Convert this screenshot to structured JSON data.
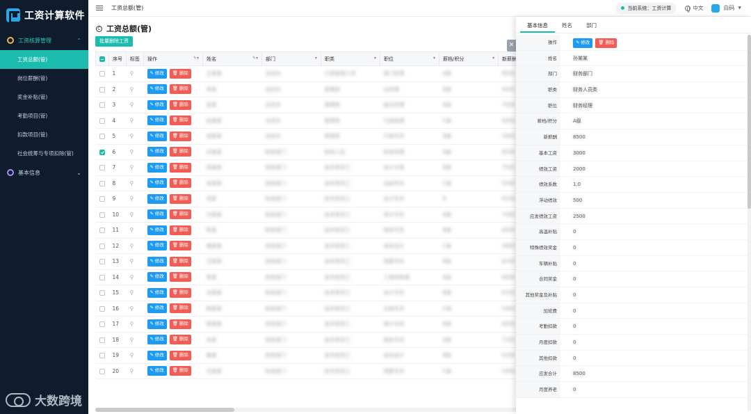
{
  "app": {
    "title": "工资计算软件"
  },
  "sidebar": {
    "groups": [
      {
        "label": "工资核算管理",
        "items": [
          "工资总额(管)",
          "岗位薪酬(管)",
          "奖金补贴(管)",
          "考勤项目(管)",
          "扣款项目(管)",
          "社会统筹与专项扣除(管)"
        ]
      },
      {
        "label": "基本信息"
      }
    ],
    "active_item": "工资总额(管)",
    "watermark": "大数跨境"
  },
  "topbar": {
    "breadcrumb": "工资总额(管)",
    "system_label": "当前系统：工资计算",
    "language": "中文",
    "user": "白码"
  },
  "page": {
    "title": "工资总额(管)",
    "batch_delete_label": "批量删除工资"
  },
  "table": {
    "columns": [
      "序号",
      "标签",
      "操作",
      "姓名",
      "部门",
      "职类",
      "职位",
      "薪档/积分",
      "新薪酬"
    ],
    "edit_label": "修改",
    "delete_label": "删除",
    "rows": [
      {
        "no": "1",
        "checked": false,
        "name": "王某某",
        "dept": "总经办",
        "cat": "行政管理人员",
        "pos": "部门经理",
        "grade": "A级",
        "pay": "8000"
      },
      {
        "no": "2",
        "checked": false,
        "name": "李某",
        "dept": "总经办",
        "cat": "管理类",
        "pos": "总经理",
        "grade": "B级",
        "pay": "9000"
      },
      {
        "no": "3",
        "checked": false,
        "name": "张某",
        "dept": "总经办",
        "cat": "管理类",
        "pos": "副总经理",
        "grade": "A级",
        "pay": "7000"
      },
      {
        "no": "4",
        "checked": false,
        "name": "赵某某",
        "dept": "总经办",
        "cat": "管理类",
        "pos": "行政助理",
        "grade": "C级",
        "pay": "6000"
      },
      {
        "no": "5",
        "checked": false,
        "name": "钱某某",
        "dept": "总经办",
        "cat": "管理类",
        "pos": "行政专员",
        "grade": "B级",
        "pay": "5000"
      },
      {
        "no": "6",
        "checked": true,
        "name": "孙某某",
        "dept": "财务部门",
        "cat": "财务人员",
        "pos": "财务经理",
        "grade": "A级",
        "pay": "8500"
      },
      {
        "no": "7",
        "checked": false,
        "name": "周某某",
        "dept": "财务部门",
        "cat": "技术类员工",
        "pos": "会计主管",
        "grade": "B级",
        "pay": "7500"
      },
      {
        "no": "8",
        "checked": false,
        "name": "吴某某",
        "dept": "财务部门",
        "cat": "技术类员工",
        "pos": "出纳专员",
        "grade": "C级",
        "pay": "5500"
      },
      {
        "no": "9",
        "checked": false,
        "name": "郑某",
        "dept": "财务部门",
        "cat": "技术类员工",
        "pos": "会计专员",
        "grade": "B",
        "pay": "6500"
      },
      {
        "no": "10",
        "checked": false,
        "name": "冯某某",
        "dept": "财务部门",
        "cat": "技术类员工",
        "pos": "审计专员",
        "grade": "A级",
        "pay": "7000"
      },
      {
        "no": "11",
        "checked": false,
        "name": "陈某",
        "dept": "财务部门",
        "cat": "技术类员工",
        "pos": "税务专员",
        "grade": "B级",
        "pay": "6000"
      },
      {
        "no": "12",
        "checked": false,
        "name": "褚某某",
        "dept": "财务部门",
        "cat": "技术类员工",
        "pos": "成本会计",
        "grade": "C级",
        "pay": "5800"
      },
      {
        "no": "13",
        "checked": false,
        "name": "卫某某",
        "dept": "财务部门",
        "cat": "技术类员工",
        "pos": "预算专员",
        "grade": "B级",
        "pay": "6200"
      },
      {
        "no": "14",
        "checked": false,
        "name": "蒋某",
        "dept": "财务部门",
        "cat": "技术类员工",
        "pos": "工程师助理",
        "grade": "A级",
        "pay": "6800"
      },
      {
        "no": "15",
        "checked": false,
        "name": "沈某某",
        "dept": "财务部门",
        "cat": "技术类员工",
        "pos": "会计专员",
        "grade": "B级",
        "pay": "6100"
      },
      {
        "no": "16",
        "checked": false,
        "name": "韩某某",
        "dept": "财务部门",
        "cat": "技术类员工",
        "pos": "出纳专员",
        "grade": "C级",
        "pay": "5400"
      },
      {
        "no": "17",
        "checked": false,
        "name": "杨某某",
        "dept": "财务部门",
        "cat": "技术类员工",
        "pos": "审计专员",
        "grade": "B级",
        "pay": "6600"
      },
      {
        "no": "18",
        "checked": false,
        "name": "朱某",
        "dept": "财务部门",
        "cat": "技术类员工",
        "pos": "税务专员",
        "grade": "A级",
        "pay": "7200"
      },
      {
        "no": "19",
        "checked": false,
        "name": "秦某",
        "dept": "财务部门",
        "cat": "技术类员工",
        "pos": "成本会计",
        "grade": "B级",
        "pay": "6300"
      },
      {
        "no": "20",
        "checked": false,
        "name": "尤某某",
        "dept": "财务部门",
        "cat": "技术类员工",
        "pos": "预算专员",
        "grade": "C级",
        "pay": "5900"
      }
    ]
  },
  "drawer": {
    "tabs": [
      "基本信息",
      "姓名",
      "部门"
    ],
    "active_tab": "基本信息",
    "edit_label": "修改",
    "delete_label": "删除",
    "fields": [
      {
        "label": "操作",
        "value": ""
      },
      {
        "label": "姓名",
        "value": "孙某某"
      },
      {
        "label": "部门",
        "value": "财务部门"
      },
      {
        "label": "职类",
        "value": "财务人员类"
      },
      {
        "label": "职位",
        "value": "财务经理"
      },
      {
        "label": "薪档/积分",
        "value": "A级"
      },
      {
        "label": "新薪酬",
        "value": "8500"
      },
      {
        "label": "基本工资",
        "value": "3000"
      },
      {
        "label": "绩效工资",
        "value": "2000"
      },
      {
        "label": "绩效系数",
        "value": "1.0"
      },
      {
        "label": "浮动绩效",
        "value": "500"
      },
      {
        "label": "应发绩效工资",
        "value": "2500"
      },
      {
        "label": "高温补贴",
        "value": "0"
      },
      {
        "label": "特殊绩效奖金",
        "value": "0"
      },
      {
        "label": "车辆补贴",
        "value": "0"
      },
      {
        "label": "合同奖金",
        "value": "0"
      },
      {
        "label": "其他奖金及补贴",
        "value": "0"
      },
      {
        "label": "加班费",
        "value": "0"
      },
      {
        "label": "考勤扣款",
        "value": "0"
      },
      {
        "label": "月度扣款",
        "value": "0"
      },
      {
        "label": "其他扣款",
        "value": "0"
      },
      {
        "label": "应发合计",
        "value": "8500"
      },
      {
        "label": "月度养老",
        "value": "0"
      }
    ]
  }
}
